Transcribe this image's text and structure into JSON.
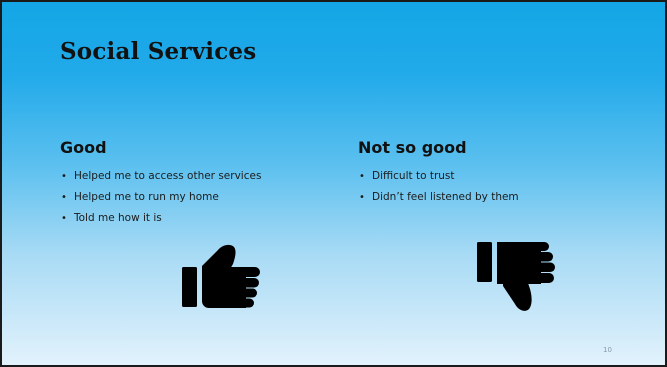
{
  "slide": {
    "title": "Social Services",
    "good": {
      "heading": "Good",
      "items": [
        "Helped me to access other services",
        "Helped me to run my home",
        "Told me how it is"
      ]
    },
    "not_so_good": {
      "heading": "Not so good",
      "items": [
        "Difficult to trust",
        "Didn’t feel listened by them"
      ]
    },
    "icons": {
      "good": "thumbs-up-icon",
      "not_so_good": "thumbs-down-icon"
    },
    "page_number": "10",
    "colors": {
      "background_top": "#13a6e6",
      "background_bottom": "#e2f2fc",
      "text": "#111111"
    }
  }
}
